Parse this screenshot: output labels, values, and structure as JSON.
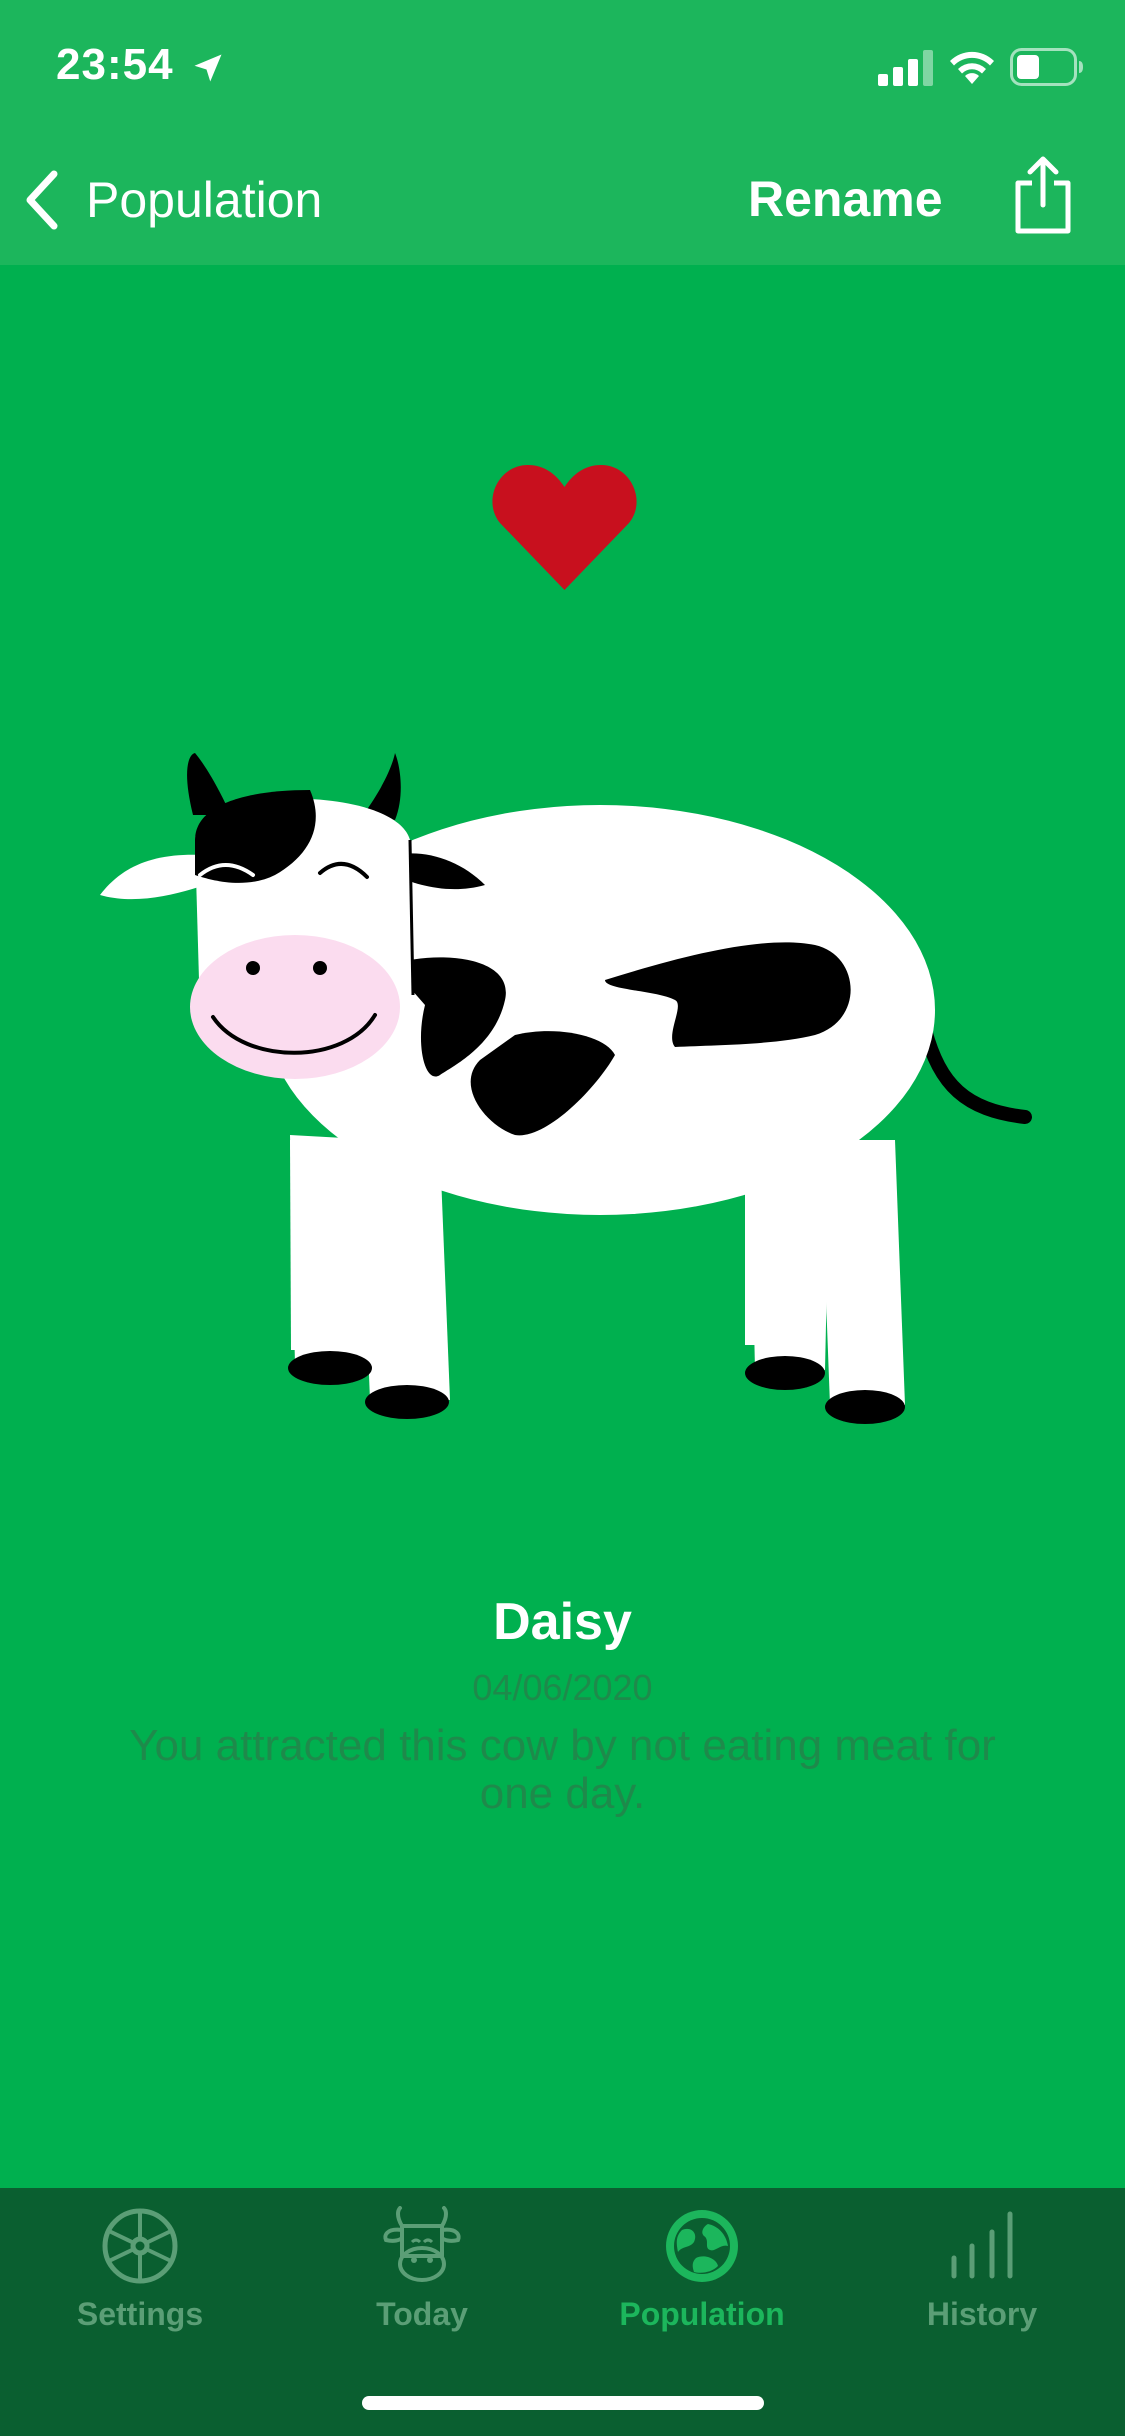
{
  "status_bar": {
    "time": "23:54",
    "icons": [
      "location-arrow-icon",
      "cellular-signal-icon",
      "wifi-icon",
      "battery-icon"
    ]
  },
  "nav": {
    "back_label": "Population",
    "rename_label": "Rename",
    "share_icon": "share-icon"
  },
  "cow": {
    "name": "Daisy",
    "date": "04/06/2020",
    "description": "You attracted this cow by not eating meat for one day."
  },
  "tabs": [
    {
      "label": "Settings",
      "icon": "wheel-icon",
      "active": false
    },
    {
      "label": "Today",
      "icon": "cow-face-icon",
      "active": false
    },
    {
      "label": "Population",
      "icon": "globe-icon",
      "active": true
    },
    {
      "label": "History",
      "icon": "bar-chart-icon",
      "active": false
    }
  ],
  "colors": {
    "background": "#00b04f",
    "nav_bar": "#1cb65c",
    "tab_bar": "#0a5f30",
    "heart": "#c8101e",
    "subtle_text": "#1e8a4b"
  }
}
